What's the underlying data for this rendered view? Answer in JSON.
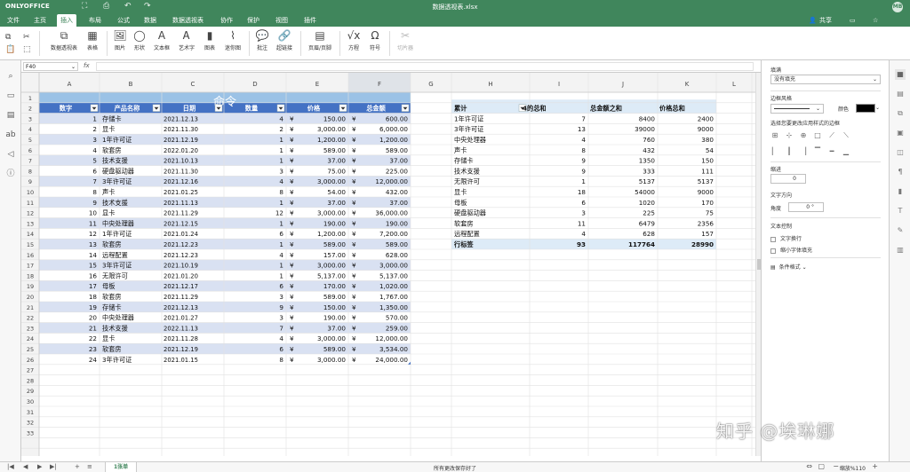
{
  "app": {
    "logo": "ONLYOFFICE",
    "title": "数据透视表.xlsx",
    "user_initials": "MB"
  },
  "menu": {
    "tabs": [
      "文件",
      "主页",
      "插入",
      "布局",
      "公式",
      "数据",
      "数据透视表",
      "协作",
      "保护",
      "视图",
      "插件"
    ],
    "active": "插入",
    "share": "共享"
  },
  "toolbar": {
    "buttons": [
      {
        "icon": "⧉",
        "label": "数据透视表",
        "name": "pivot-table-button"
      },
      {
        "icon": "▦",
        "label": "表格",
        "name": "table-button"
      },
      {
        "icon": "🖼",
        "label": "图片",
        "name": "image-button"
      },
      {
        "icon": "◯",
        "label": "形状",
        "name": "shape-button"
      },
      {
        "icon": "A",
        "label": "文本框",
        "name": "textbox-button"
      },
      {
        "icon": "Ꭺ",
        "label": "艺术字",
        "name": "text-art-button"
      },
      {
        "icon": "▮",
        "label": "图表",
        "name": "chart-button"
      },
      {
        "icon": "⌇",
        "label": "迷你图",
        "name": "sparkline-button"
      },
      {
        "icon": "💬",
        "label": "批注",
        "name": "comment-button"
      },
      {
        "icon": "🔗",
        "label": "超链接",
        "name": "hyperlink-button"
      },
      {
        "icon": "▤",
        "label": "页眉/页脚",
        "name": "header-footer-button"
      },
      {
        "icon": "√x",
        "label": "方程",
        "name": "equation-button"
      },
      {
        "icon": "Ω",
        "label": "符号",
        "name": "symbol-button"
      },
      {
        "icon": "✂",
        "label": "切片器",
        "name": "slicer-button"
      }
    ]
  },
  "formula_bar": {
    "cell_ref": "F40",
    "fx": "fx",
    "value": ""
  },
  "grid": {
    "columns": [
      "A",
      "B",
      "C",
      "D",
      "E",
      "F",
      "G",
      "H",
      "I",
      "J",
      "K",
      "L"
    ],
    "row_numbers": [
      "1",
      "2",
      "3",
      "4",
      "5",
      "6",
      "7",
      "8",
      "9",
      "10",
      "11",
      "12",
      "13",
      "14",
      "15",
      "16",
      "17",
      "18",
      "19",
      "20",
      "21",
      "22",
      "23",
      "24",
      "25",
      "26",
      "27",
      "28",
      "29",
      "30",
      "31",
      "32",
      "33"
    ],
    "table_title": "命令",
    "table_headers": [
      "数字",
      "产品名称",
      "日期",
      "数量",
      "价格",
      "总金额"
    ],
    "currency": "¥",
    "table_rows": [
      [
        "1",
        "存储卡",
        "2021.12.13",
        "4",
        "150.00",
        "600.00"
      ],
      [
        "2",
        "显卡",
        "2021.11.30",
        "2",
        "3,000.00",
        "6,000.00"
      ],
      [
        "3",
        "1年许可证",
        "2021.12.19",
        "1",
        "1,200.00",
        "1,200.00"
      ],
      [
        "4",
        "软套房",
        "2022.01.20",
        "1",
        "589.00",
        "589.00"
      ],
      [
        "5",
        "技术支援",
        "2021.10.13",
        "1",
        "37.00",
        "37.00"
      ],
      [
        "6",
        "硬盘驱动器",
        "2021.11.30",
        "3",
        "75.00",
        "225.00"
      ],
      [
        "7",
        "3年许可证",
        "2021.12.16",
        "4",
        "3,000.00",
        "12,000.00"
      ],
      [
        "8",
        "声卡",
        "2021.01.25",
        "8",
        "54.00",
        "432.00"
      ],
      [
        "9",
        "技术支援",
        "2021.11.13",
        "1",
        "37.00",
        "37.00"
      ],
      [
        "10",
        "显卡",
        "2021.11.29",
        "12",
        "3,000.00",
        "36,000.00"
      ],
      [
        "11",
        "中央处理器",
        "2021.12.15",
        "1",
        "190.00",
        "190.00"
      ],
      [
        "12",
        "1年许可证",
        "2021.01.24",
        "6",
        "1,200.00",
        "7,200.00"
      ],
      [
        "13",
        "软套房",
        "2021.12.23",
        "1",
        "589.00",
        "589.00"
      ],
      [
        "14",
        "远程配置",
        "2021.12.23",
        "4",
        "157.00",
        "628.00"
      ],
      [
        "15",
        "3年许可证",
        "2021.10.19",
        "1",
        "3,000.00",
        "3,000.00"
      ],
      [
        "16",
        "无限许可",
        "2021.01.20",
        "1",
        "5,137.00",
        "5,137.00"
      ],
      [
        "17",
        "母板",
        "2021.12.17",
        "6",
        "170.00",
        "1,020.00"
      ],
      [
        "18",
        "软套房",
        "2021.11.29",
        "3",
        "589.00",
        "1,767.00"
      ],
      [
        "19",
        "存储卡",
        "2021.12.13",
        "9",
        "150.00",
        "1,350.00"
      ],
      [
        "20",
        "中央处理器",
        "2021.01.27",
        "3",
        "190.00",
        "570.00"
      ],
      [
        "21",
        "技术支援",
        "2022.11.13",
        "7",
        "37.00",
        "259.00"
      ],
      [
        "22",
        "显卡",
        "2021.11.28",
        "4",
        "3,000.00",
        "12,000.00"
      ],
      [
        "23",
        "软套房",
        "2021.12.19",
        "6",
        "589.00",
        "3,534.00"
      ],
      [
        "24",
        "3年许可证",
        "2021.01.15",
        "8",
        "3,000.00",
        "24,000.00"
      ]
    ],
    "pivot_headers": [
      "累计",
      "4的总和",
      "总金额之和",
      "价格总和"
    ],
    "pivot_rows": [
      [
        "1年许可证",
        "7",
        "8400",
        "2400"
      ],
      [
        "3年许可证",
        "13",
        "39000",
        "9000"
      ],
      [
        "中央处理器",
        "4",
        "760",
        "380"
      ],
      [
        "声卡",
        "8",
        "432",
        "54"
      ],
      [
        "存储卡",
        "9",
        "1350",
        "150"
      ],
      [
        "技术支援",
        "9",
        "333",
        "111"
      ],
      [
        "无限许可",
        "1",
        "5137",
        "5137"
      ],
      [
        "显卡",
        "18",
        "54000",
        "9000"
      ],
      [
        "母板",
        "6",
        "1020",
        "170"
      ],
      [
        "硬盘驱动器",
        "3",
        "225",
        "75"
      ],
      [
        "软套房",
        "11",
        "6479",
        "2356"
      ],
      [
        "远程配置",
        "4",
        "628",
        "157"
      ]
    ],
    "pivot_total": [
      "行标签",
      "93",
      "117764",
      "28990"
    ]
  },
  "right_panel": {
    "fill_label": "填满",
    "fill_value": "没有填充",
    "border_style_label": "边框风格",
    "color_label": "颜色",
    "border_hint": "选择您要更改应用样式的边框",
    "indent_label": "缩进",
    "indent_value": "0",
    "text_direction_label": "文字方向",
    "angle_label": "角度",
    "angle_value": "0 °",
    "text_control_label": "文本控制",
    "wrap_text": "文字换行",
    "shrink_to_fit": "缩小字体填充",
    "conditional_format": "条件格式"
  },
  "status": {
    "sheet": "1张单",
    "saved": "所有更改保存好了",
    "zoom": "缩放%110"
  },
  "watermark": "知乎 @埃琳娜",
  "colors": {
    "accent": "#40865c",
    "table_header": "#4472c4",
    "table_band": "#d9e1f2",
    "table_title": "#9bc2e6",
    "pivot_header": "#ddebf7"
  }
}
